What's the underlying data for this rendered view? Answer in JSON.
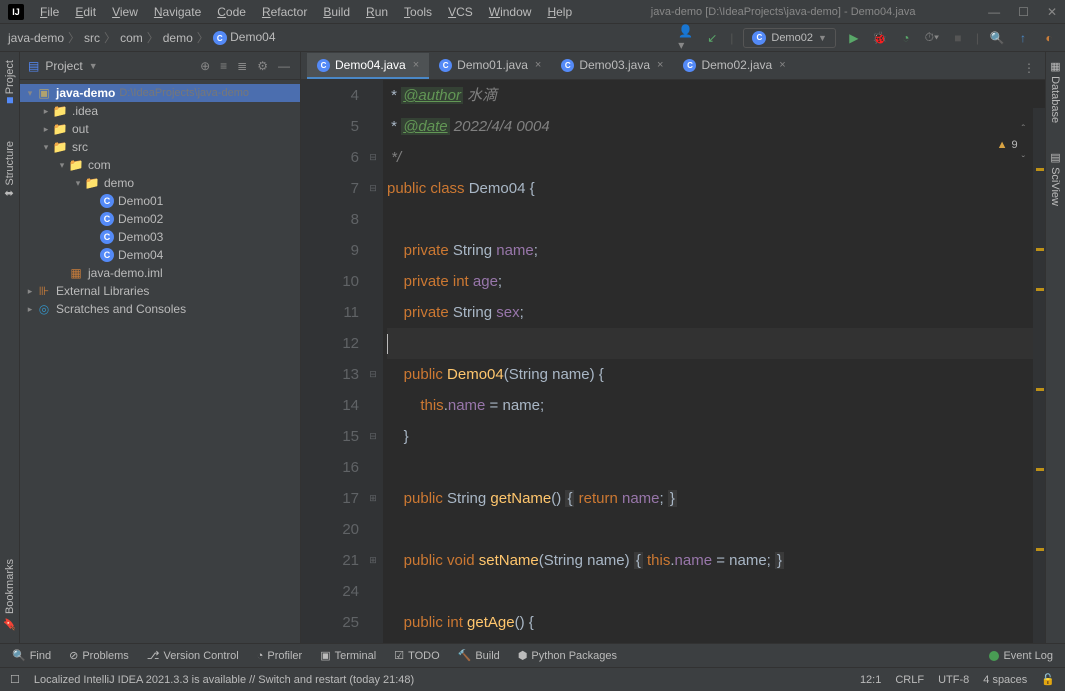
{
  "window": {
    "title": "java-demo [D:\\IdeaProjects\\java-demo] - Demo04.java",
    "menus": [
      "File",
      "Edit",
      "View",
      "Navigate",
      "Code",
      "Refactor",
      "Build",
      "Run",
      "Tools",
      "VCS",
      "Window",
      "Help"
    ]
  },
  "breadcrumbs": {
    "items": [
      "java-demo",
      "src",
      "com",
      "demo",
      "Demo04"
    ]
  },
  "run_config": {
    "name": "Demo02"
  },
  "project_panel": {
    "title": "Project"
  },
  "tree": {
    "root": {
      "name": "java-demo",
      "path": "D:\\IdeaProjects\\java-demo"
    },
    "idea": ".idea",
    "out": "out",
    "src": "src",
    "com": "com",
    "demo": "demo",
    "classes": [
      "Demo01",
      "Demo02",
      "Demo03",
      "Demo04"
    ],
    "iml": "java-demo.iml",
    "ext_libs": "External Libraries",
    "scratches": "Scratches and Consoles"
  },
  "tabs": [
    {
      "label": "Demo04.java",
      "active": true
    },
    {
      "label": "Demo01.java",
      "active": false
    },
    {
      "label": "Demo03.java",
      "active": false
    },
    {
      "label": "Demo02.java",
      "active": false
    }
  ],
  "editor_warning_count": "9",
  "code_lines": [
    {
      "num": "4",
      "html": " * <span class='hl-doctag'>@author</span> <span class='hl-comment'>水滴</span>"
    },
    {
      "num": "5",
      "html": " * <span class='hl-doctag'>@date</span> <span class='hl-comment'>2022/4/4 0004</span>"
    },
    {
      "num": "6",
      "html": " <span class='hl-comment'>*/</span>"
    },
    {
      "num": "7",
      "html": "<span class='hl-keyword'>public class</span> <span class='hl-type'>Demo04</span> {"
    },
    {
      "num": "8",
      "html": ""
    },
    {
      "num": "9",
      "html": "    <span class='hl-keyword'>private</span> String <span class='hl-field'>name</span>;"
    },
    {
      "num": "10",
      "html": "    <span class='hl-keyword'>private int</span> <span class='hl-field'>age</span>;"
    },
    {
      "num": "11",
      "html": "    <span class='hl-keyword'>private</span> String <span class='hl-field'>sex</span>;"
    },
    {
      "num": "12",
      "html": "",
      "current": true
    },
    {
      "num": "13",
      "html": "    <span class='hl-keyword'>public</span> <span class='hl-method'>Demo04</span>(String name) {"
    },
    {
      "num": "14",
      "html": "        <span class='hl-this'>this</span>.<span class='hl-field'>name</span> = name;"
    },
    {
      "num": "15",
      "html": "    }"
    },
    {
      "num": "16",
      "html": ""
    },
    {
      "num": "17",
      "html": "    <span class='hl-keyword'>public</span> String <span class='hl-method'>getName</span>() <span class='hl-dim'>{</span> <span class='hl-keyword'>return</span> <span class='hl-field'>name</span>; <span class='hl-dim'>}</span>"
    },
    {
      "num": "20",
      "html": ""
    },
    {
      "num": "21",
      "html": "    <span class='hl-keyword'>public void</span> <span class='hl-method'>setName</span>(String name) <span class='hl-dim'>{</span> <span class='hl-this'>this</span>.<span class='hl-field'>name</span> = name; <span class='hl-dim'>}</span>"
    },
    {
      "num": "24",
      "html": ""
    },
    {
      "num": "25",
      "html": "    <span class='hl-keyword'>public int</span> <span class='hl-method'>getAge</span>() {"
    }
  ],
  "left_tabs": [
    "Project",
    "Structure"
  ],
  "left_bottom_tab": "Bookmarks",
  "right_tabs": [
    "Database",
    "SciView"
  ],
  "bottom_tools": {
    "find": "Find",
    "problems": "Problems",
    "vcs": "Version Control",
    "profiler": "Profiler",
    "terminal": "Terminal",
    "todo": "TODO",
    "build": "Build",
    "python": "Python Packages",
    "event_log": "Event Log"
  },
  "status": {
    "message": "Localized IntelliJ IDEA 2021.3.3 is available // Switch and restart (today 21:48)",
    "position": "12:1",
    "line_sep": "CRLF",
    "encoding": "UTF-8",
    "indent": "4 spaces"
  }
}
